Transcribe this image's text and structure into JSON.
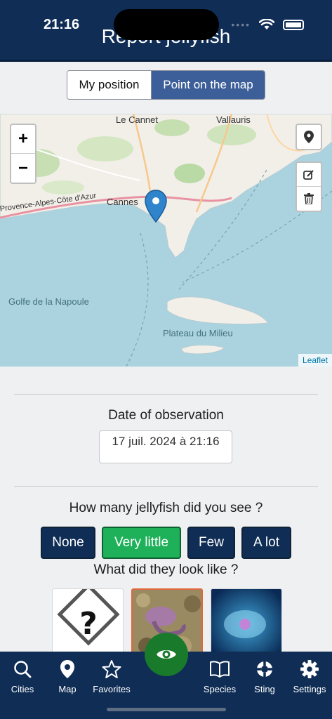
{
  "status_bar": {
    "time": "21:16"
  },
  "header": {
    "title": "Report jellyfish"
  },
  "position_toggle": {
    "options": [
      "My position",
      "Point on the map"
    ],
    "selected": "Point on the map"
  },
  "map": {
    "place_labels": [
      "Le Cannet",
      "Vallauris",
      "Provence-Alpes-Côte d'Azur",
      "Cannes",
      "Golfe de la Napoule",
      "Plateau du Milieu"
    ],
    "zoom_in": "+",
    "zoom_out": "−",
    "attribution": "Leaflet",
    "locate_icon": "location-pin-icon",
    "edit_icon": "edit-icon",
    "delete_icon": "trash-icon"
  },
  "date_section": {
    "label": "Date of observation",
    "value": "17 juil. 2024 à 21:16"
  },
  "quantity_section": {
    "question": "How many jellyfish did you see ?",
    "options": [
      "None",
      "Very little",
      "Few",
      "A lot"
    ],
    "selected": "Very little"
  },
  "appearance_section": {
    "question": "What did they look like ?",
    "cards": [
      "unknown-question-icon",
      "purple-jellyfish-photo",
      "blue-moon-jellyfish-photo"
    ],
    "selected_index": 1
  },
  "tab_bar": {
    "tabs": [
      {
        "label": "Cities",
        "icon": "search-icon"
      },
      {
        "label": "Map",
        "icon": "map-pin-icon"
      },
      {
        "label": "Favorites",
        "icon": "star-icon"
      },
      {
        "label": "Species",
        "icon": "book-icon"
      },
      {
        "label": "Sting",
        "icon": "lifebuoy-icon"
      },
      {
        "label": "Settings",
        "icon": "gear-icon"
      }
    ],
    "center_icon": "eye-icon"
  },
  "colors": {
    "navy": "#0f2d55",
    "selected_green": "#1eb15a",
    "toggle_blue": "#3d5f99",
    "fab_green": "#1a7a2c",
    "card_highlight": "#e2673b"
  }
}
